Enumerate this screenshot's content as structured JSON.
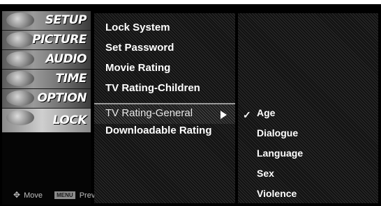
{
  "sidebar": {
    "items": [
      {
        "label": "SETUP",
        "icon": "setup-icon"
      },
      {
        "label": "PICTURE",
        "icon": "picture-icon"
      },
      {
        "label": "AUDIO",
        "icon": "audio-icon"
      },
      {
        "label": "TIME",
        "icon": "time-icon"
      },
      {
        "label": "OPTION",
        "icon": "option-icon"
      },
      {
        "label": "LOCK",
        "icon": "lock-icon"
      }
    ],
    "footer": {
      "move_icon": "✥",
      "move_label": "Move",
      "menu_key": "MENU",
      "prev_label": "Prev"
    }
  },
  "lock_menu": {
    "items": [
      {
        "label": "Lock System"
      },
      {
        "label": "Set Password"
      },
      {
        "label": "Movie Rating"
      },
      {
        "label": "TV Rating-Children"
      },
      {
        "label": "TV Rating-General"
      },
      {
        "label": "Downloadable Rating"
      }
    ],
    "selected_index": 4
  },
  "submenu": {
    "items": [
      {
        "label": "Age",
        "checked": true
      },
      {
        "label": "Dialogue"
      },
      {
        "label": "Language"
      },
      {
        "label": "Sex"
      },
      {
        "label": "Violence"
      }
    ],
    "check_glyph": "✓"
  }
}
